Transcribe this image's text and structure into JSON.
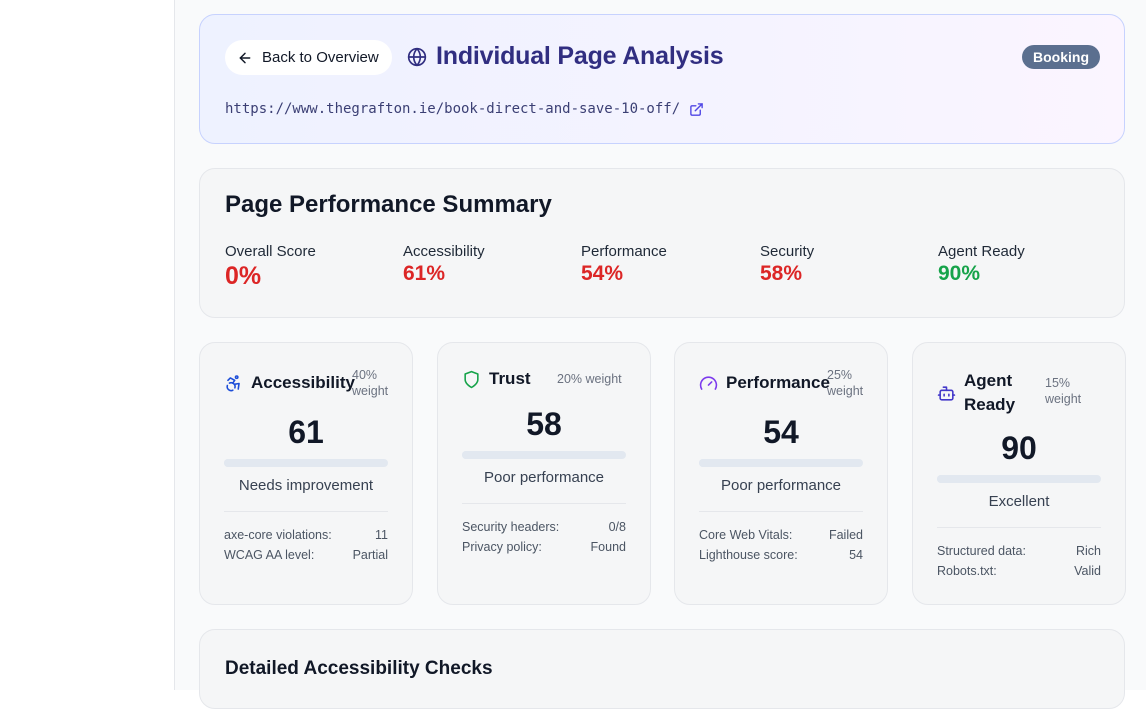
{
  "header": {
    "back_label": "Back to Overview",
    "title": "Individual Page Analysis",
    "badge": "Booking",
    "url": "https://www.thegrafton.ie/book-direct-and-save-10-off/"
  },
  "summary": {
    "title": "Page Performance Summary",
    "items": [
      {
        "label": "Overall Score",
        "value": "0%"
      },
      {
        "label": "Accessibility",
        "value": "61%"
      },
      {
        "label": "Performance",
        "value": "54%"
      },
      {
        "label": "Security",
        "value": "58%"
      },
      {
        "label": "Agent Ready",
        "value": "90%"
      }
    ]
  },
  "cards": [
    {
      "title": "Accessibility",
      "weight": "40% weight",
      "score": "61",
      "score_fraction": 0.61,
      "status": "Needs improvement",
      "rows": [
        {
          "label": "axe-core violations:",
          "value": "11"
        },
        {
          "label": "WCAG AA level:",
          "value": "Partial"
        }
      ]
    },
    {
      "title": "Trust",
      "weight": "20% weight",
      "score": "58",
      "score_fraction": 0.58,
      "status": "Poor performance",
      "rows": [
        {
          "label": "Security headers:",
          "value": "0/8"
        },
        {
          "label": "Privacy policy:",
          "value": "Found"
        }
      ]
    },
    {
      "title": "Performance",
      "weight": "25% weight",
      "score": "54",
      "score_fraction": 0.54,
      "status": "Poor performance",
      "rows": [
        {
          "label": "Core Web Vitals:",
          "value": "Failed"
        },
        {
          "label": "Lighthouse score:",
          "value": "54"
        }
      ]
    },
    {
      "title": "Agent Ready",
      "weight": "15% weight",
      "score": "90",
      "score_fraction": 0.9,
      "status": "Excellent",
      "rows": [
        {
          "label": "Structured data:",
          "value": "Rich"
        },
        {
          "label": "Robots.txt:",
          "value": "Valid"
        }
      ]
    }
  ],
  "details": {
    "title": "Detailed Accessibility Checks"
  },
  "colors": {
    "title": "#312e81",
    "badge": "#5b6f8f",
    "bad": "#dc2626",
    "good": "#16a34a",
    "accessibility_icon": "#1d4ed8",
    "trust_icon": "#16a34a",
    "performance_icon": "#7c3aed",
    "agent_icon": "#4338ca"
  },
  "icons": {
    "back": "arrow-left-icon",
    "title": "globe-icon",
    "url": "external-link-icon",
    "accessibility": "accessibility-icon",
    "trust": "shield-icon",
    "performance": "gauge-icon",
    "agent": "bot-icon"
  }
}
